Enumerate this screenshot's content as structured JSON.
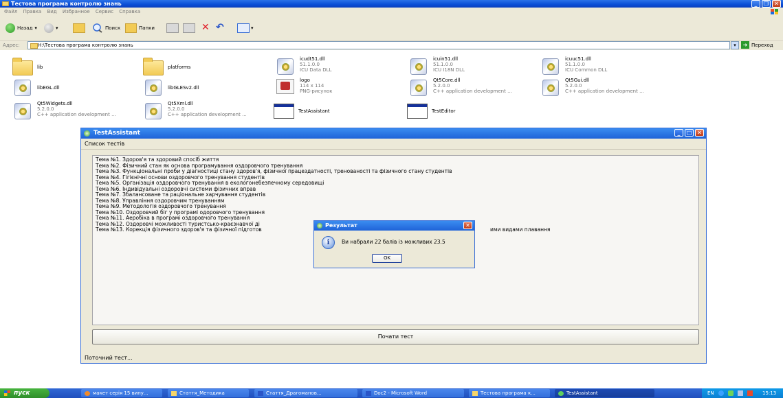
{
  "explorer": {
    "title": "Тестова програма контролю знань",
    "menu": [
      "Файл",
      "Правка",
      "Вид",
      "Избранное",
      "Сервис",
      "Справка"
    ],
    "toolbar": {
      "back": "Назад",
      "search": "Поиск",
      "folders": "Папки"
    },
    "address": {
      "label": "Адрес:",
      "path": "H:\\Тестова програма контролю знань",
      "go": "Переход"
    },
    "files": [
      {
        "name": "lib",
        "type": "folder"
      },
      {
        "name": "platforms",
        "type": "folder"
      },
      {
        "name": "icudt51.dll",
        "line2": "51.1.0.0",
        "line3": "ICU Data DLL",
        "type": "dll"
      },
      {
        "name": "icuin51.dll",
        "line2": "51.1.0.0",
        "line3": "ICU I18N DLL",
        "type": "dll"
      },
      {
        "name": "icuuc51.dll",
        "line2": "51.1.0.0",
        "line3": "ICU Common DLL",
        "type": "dll"
      },
      {
        "name": "libEGL.dll",
        "type": "dll"
      },
      {
        "name": "libGLESv2.dll",
        "type": "dll"
      },
      {
        "name": "logo",
        "line2": "114 x 114",
        "line3": "PNG-рисунок",
        "type": "png"
      },
      {
        "name": "Qt5Core.dll",
        "line2": "5.2.0.0",
        "line3": "C++ application development ...",
        "type": "dll"
      },
      {
        "name": "Qt5Gui.dll",
        "line2": "5.2.0.0",
        "line3": "C++ application development ...",
        "type": "dll"
      },
      {
        "name": "Qt5Widgets.dll",
        "line2": "5.2.0.0",
        "line3": "C++ application development ...",
        "type": "dll"
      },
      {
        "name": "Qt5Xml.dll",
        "line2": "5.2.0.0",
        "line3": "C++ application development ...",
        "type": "dll"
      },
      {
        "name": "TestAssistant",
        "type": "exe"
      },
      {
        "name": "TestEditor",
        "type": "exe"
      }
    ]
  },
  "test_assistant": {
    "title": "TestAssistant",
    "menu_label": "Список тестів",
    "topics": [
      "Тема №1. Здоров'я та здоровий спосіб життя",
      "Тема №2. Фізичний стан як основа програмування оздоровчого тренування",
      "Тема №3. Функціональні проби у діагностиці стану здоров'я, фізичної працездатності, тренованості та фізичного стану студентів",
      "Тема №4. Гігієнічні основи оздоровчого тренування студентів",
      "Тема №5. Організація оздоровчого тренування в екологонебезпечному середовищі",
      "Тема №6. Індивідуальні оздоровчі системи фізичних вправ",
      "Тема №7. Збалансоване та раціональне харчування студентів",
      "Тема №8. Управління оздоровчим тренуванням",
      "Тема №9. Методологія оздоровчого тренування",
      "Тема №10. Оздоровчий біг у програмі одоровчого тренування",
      "Тема №11. Аеробіка в програмі оздоровчого тренування",
      "Тема №12. Оздоровчі можливості туристсько-краєзнавчої ді",
      "Тема №13. Корекція фізичного здоров'я та фізичної підготов"
    ],
    "topic13_tail": "ими видами плавання",
    "start_button": "Почати тест",
    "status": "Поточний тест..."
  },
  "dialog": {
    "title": "Результат",
    "message": "Ви набрали 22 балів із можливих 23.5",
    "ok": "OK"
  },
  "taskbar": {
    "start": "пуск",
    "tasks": [
      "макет серія 15 випу...",
      "Стаття_Методика",
      "Стаття_Драгоманов...",
      "Doc2 - Microsoft Word",
      "Тестова програма к...",
      "TestAssistant"
    ],
    "lang": "EN",
    "clock": "15:13"
  }
}
